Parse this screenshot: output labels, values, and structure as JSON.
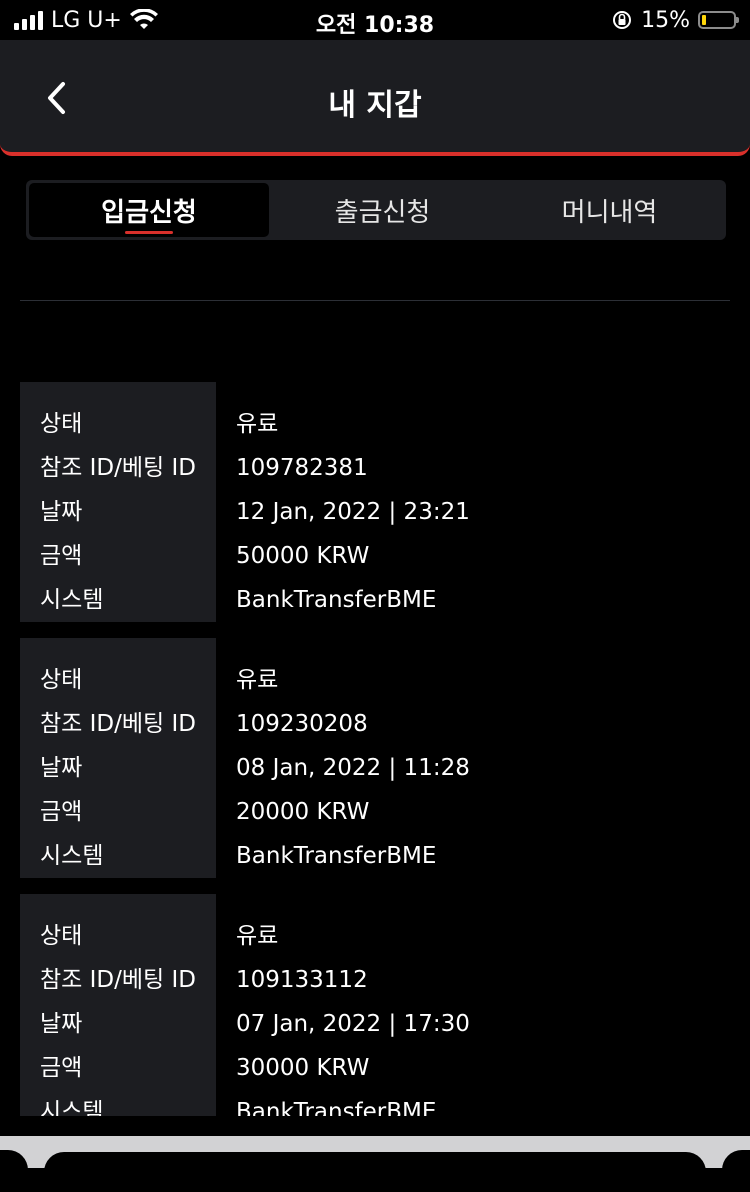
{
  "status_bar": {
    "carrier": "LG U+",
    "time": "오전 10:38",
    "battery": "15%"
  },
  "header": {
    "title": "내 지갑"
  },
  "tabs": [
    {
      "label": "입금신청"
    },
    {
      "label": "출금신청"
    },
    {
      "label": "머니내역"
    }
  ],
  "labels": {
    "status": "상태",
    "ref": "참조 ID/베팅 ID",
    "date": "날짜",
    "amount": "금액",
    "system": "시스템"
  },
  "transactions": [
    {
      "status": "유료",
      "ref": "109782381",
      "date": "12 Jan, 2022 | 23:21",
      "amount": "50000 KRW",
      "system": "BankTransferBME"
    },
    {
      "status": "유료",
      "ref": "109230208",
      "date": "08 Jan, 2022 | 11:28",
      "amount": "20000 KRW",
      "system": "BankTransferBME"
    },
    {
      "status": "유료",
      "ref": "109133112",
      "date": "07 Jan, 2022 | 17:30",
      "amount": "30000 KRW",
      "system": "BankTransferBME"
    }
  ],
  "colors": {
    "accent": "#d9302b",
    "panel": "#1c1d21",
    "background": "#000000"
  }
}
